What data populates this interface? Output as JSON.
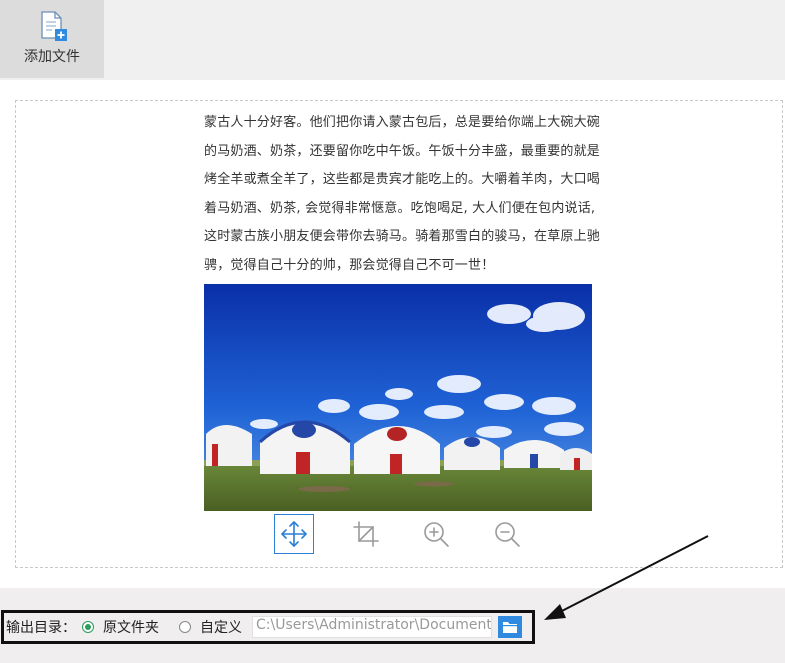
{
  "toolbar": {
    "add_file_label": "添加文件"
  },
  "preview": {
    "text_lines": [
      "蒙古人十分好客。他们把你请入蒙古包后，总是要给你端上大碗大碗",
      "的马奶酒、奶茶，还要留你吃中午饭。午饭十分丰盛，最重要的就是",
      "烤全羊或煮全羊了，这些都是贵宾才能吃上的。大嚼着羊肉，大口喝",
      "着马奶酒、奶茶, 会觉得非常惬意。吃饱喝足, 大人们便在包内说话,",
      "这时蒙古族小朋友便会带你去骑马。骑着那雪白的骏马，在草原上驰",
      "骋，觉得自己十分的帅，那会觉得自己不可一世！"
    ],
    "image_alt": "yurts-on-grassland"
  },
  "tools": {
    "move": "move-icon",
    "crop": "crop-icon",
    "zoom_in": "zoom-in-icon",
    "zoom_out": "zoom-out-icon"
  },
  "output": {
    "label": "输出目录：",
    "option_original": "原文件夹",
    "option_custom": "自定义",
    "path_value": "C:\\Users\\Administrator\\Documents",
    "selected": "original"
  },
  "colors": {
    "accent": "#2f8ae0",
    "radio_checked": "#2a9d5c"
  }
}
